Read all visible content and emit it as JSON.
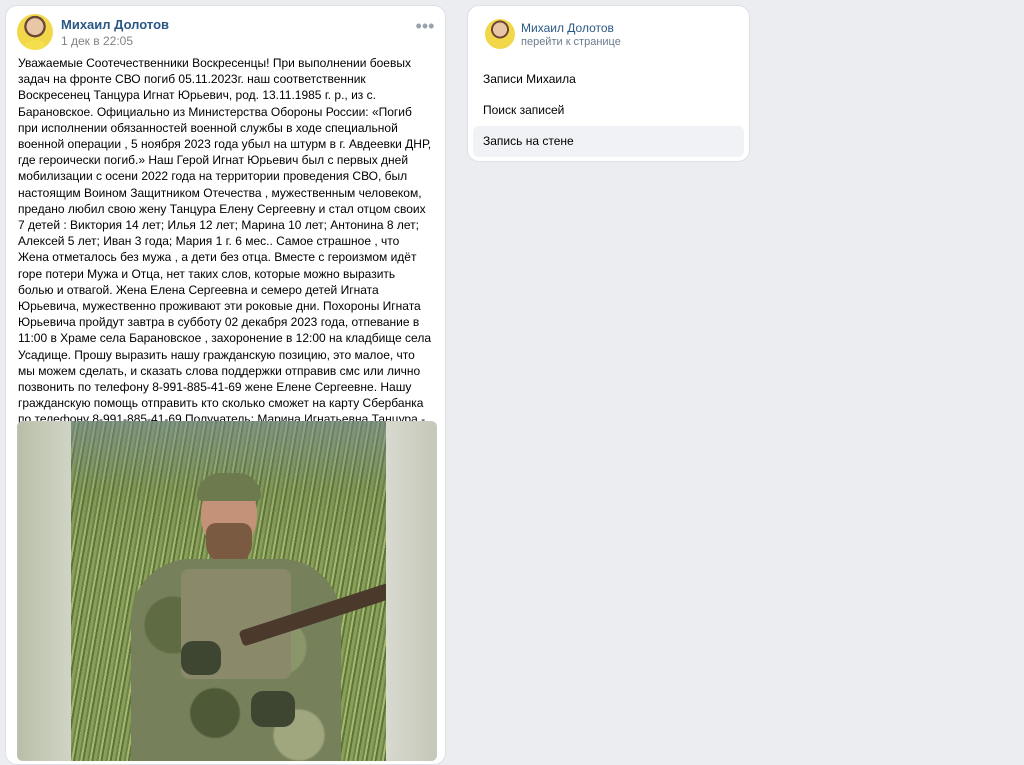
{
  "post": {
    "author": "Михаил Долотов",
    "date": "1 дек в 22:05",
    "more_icon": "more-horizontal-icon",
    "text": "Уважаемые Соотечественники Воскресенцы! При выполнении боевых задач на фронте СВО погиб 05.11.2023г. наш соответственник Воскресенец Танцура Игнат Юрьевич, род. 13.11.1985 г. р., из с. Барановское. Официально из Министерства Обороны России: «Погиб при исполнении обязанностей военной службы в ходе специальной военной операции , 5 ноября 2023 года убыл на штурм в г. Авдеевки ДНР, где героически погиб.» Наш Герой Игнат Юрьевич был с первых дней мобилизации с осени 2022 года на территории проведения СВО, был настоящим Воином Защитником Отечества , мужественным человеком, предано любил свою жену Танцура Елену Сергеевну и стал отцом своих 7 детей : Виктория 14 лет; Илья 12 лет; Марина 10 лет; Антонина 8 лет; Алексей 5 лет; Иван 3 года; Мария 1 г. 6 мес.. Самое страшное , что Жена отметалось без мужа , а дети без отца. Вместе с героизмом идёт горе потери Мужа и Отца, нет таких слов, которые можно выразить болью и отвагой. Жена Елена Сергеевна и семеро детей Игната Юрьевича, мужественно проживают эти роковые дни. Похороны Игната Юрьевича пройдут завтра в субботу 02 декабря 2023 года, отпевание в 11:00 в Храме села Барановское , захоронение в 12:00 на кладбище села Усадище. Прошу выразить нашу гражданскую позицию, это малое, что мы можем сделать, и сказать слова поддержки отправив смс или лично позвонить по телефону 8-991-885-41-69 жене Елене Сергеевне. Нашу гражданскую помощь отправить кто сколько сможет на карту Сбербанка по телефону 8-991-885-41-69 Получатель: Марина Игнатьевна Танцура - дочь. В минуты роковые Русской народ проявляется самые лучшие качества русского народа- сострадание и милосердие! С уважением, жители городского округа Воскресенск МО!"
  },
  "sidebar": {
    "author": "Михаил Долотов",
    "goto": "перейти к странице",
    "items": [
      {
        "label": "Записи Михаила",
        "active": false
      },
      {
        "label": "Поиск записей",
        "active": false
      },
      {
        "label": "Запись на стене",
        "active": true
      }
    ]
  }
}
